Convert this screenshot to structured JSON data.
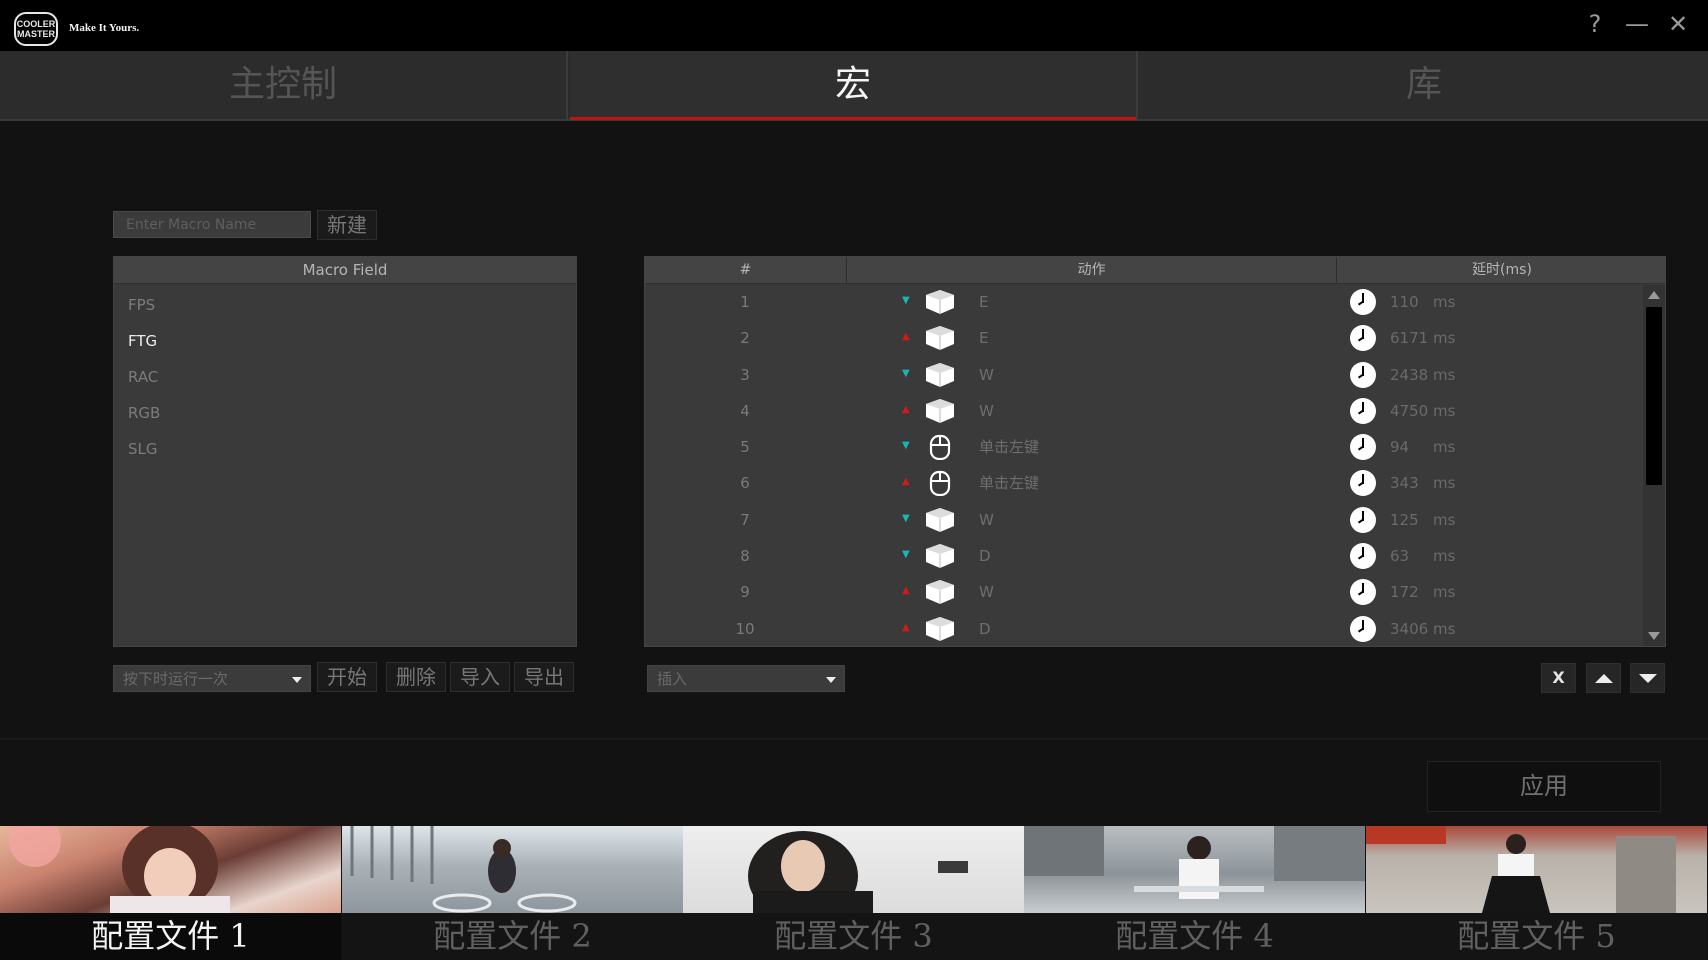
{
  "window": {
    "brand_logo_text": "COOLER MASTER",
    "tagline": "Make It Yours.",
    "help_glyph": "?",
    "minimize_glyph": "—",
    "close_glyph": "✕"
  },
  "tabs": [
    {
      "label": "主控制",
      "active": false
    },
    {
      "label": "宏",
      "active": true
    },
    {
      "label": "库",
      "active": false
    }
  ],
  "macro_editor": {
    "name_placeholder": "Enter Macro Name",
    "new_label": "新建",
    "field_header": "Macro Field",
    "macros": [
      {
        "name": "FPS",
        "selected": false
      },
      {
        "name": "FTG",
        "selected": true
      },
      {
        "name": "RAC",
        "selected": false
      },
      {
        "name": "RGB",
        "selected": false
      },
      {
        "name": "SLG",
        "selected": false
      }
    ],
    "run_mode": "按下时运行一次",
    "start_label": "开始",
    "delete_label": "删除",
    "import_label": "导入",
    "export_label": "导出"
  },
  "action_table": {
    "headers": {
      "index": "#",
      "action": "动作",
      "delay": "延时(ms)"
    },
    "rows": [
      {
        "index": "1",
        "direction": "down",
        "device": "keyboard-key-icon",
        "key": "E",
        "delay": "110",
        "unit": "ms"
      },
      {
        "index": "2",
        "direction": "up",
        "device": "keyboard-key-icon",
        "key": "E",
        "delay": "6171",
        "unit": "ms"
      },
      {
        "index": "3",
        "direction": "down",
        "device": "keyboard-key-icon",
        "key": "W",
        "delay": "2438",
        "unit": "ms"
      },
      {
        "index": "4",
        "direction": "up",
        "device": "keyboard-key-icon",
        "key": "W",
        "delay": "4750",
        "unit": "ms"
      },
      {
        "index": "5",
        "direction": "down",
        "device": "mouse-icon",
        "key": "单击左键",
        "delay": "94",
        "unit": "ms"
      },
      {
        "index": "6",
        "direction": "up",
        "device": "mouse-icon",
        "key": "单击左键",
        "delay": "343",
        "unit": "ms"
      },
      {
        "index": "7",
        "direction": "down",
        "device": "keyboard-key-icon",
        "key": "W",
        "delay": "125",
        "unit": "ms"
      },
      {
        "index": "8",
        "direction": "down",
        "device": "keyboard-key-icon",
        "key": "D",
        "delay": "63",
        "unit": "ms"
      },
      {
        "index": "9",
        "direction": "up",
        "device": "keyboard-key-icon",
        "key": "W",
        "delay": "172",
        "unit": "ms"
      },
      {
        "index": "10",
        "direction": "up",
        "device": "keyboard-key-icon",
        "key": "D",
        "delay": "3406",
        "unit": "ms"
      }
    ],
    "insert_mode": "插入",
    "remove_label": "X"
  },
  "apply_label": "应用",
  "profiles": [
    {
      "label": "配置文件 1",
      "active": true
    },
    {
      "label": "配置文件 2",
      "active": false
    },
    {
      "label": "配置文件 3",
      "active": false
    },
    {
      "label": "配置文件 4",
      "active": false
    },
    {
      "label": "配置文件 5",
      "active": false
    }
  ],
  "colors": {
    "accent_red": "#c41212",
    "key_down": "#18b7b0",
    "key_up": "#d11b1b"
  }
}
